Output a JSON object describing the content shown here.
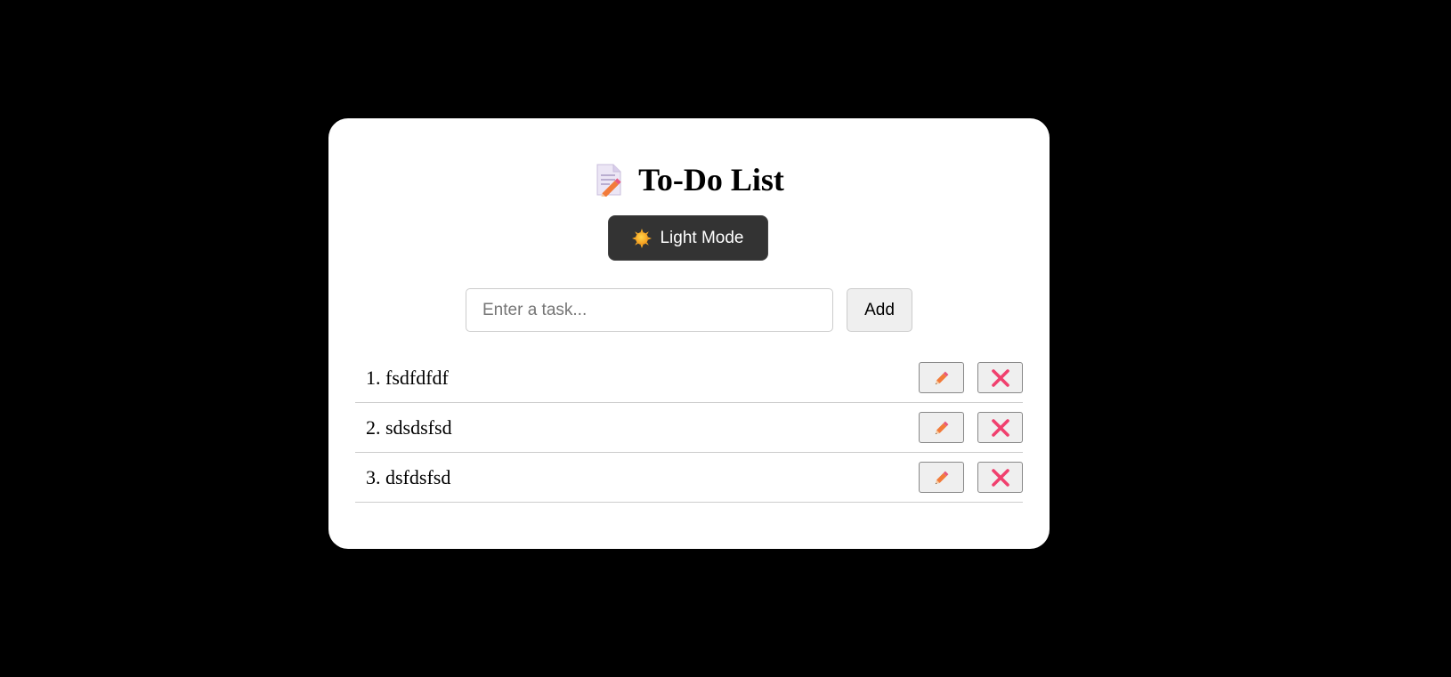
{
  "app": {
    "title": "To-Do List",
    "title_icon": "memo-pencil-icon"
  },
  "theme_toggle": {
    "label": "Light Mode",
    "icon": "sun-icon"
  },
  "new_task": {
    "placeholder": "Enter a task...",
    "value": "",
    "add_label": "Add"
  },
  "tasks": [
    {
      "label": "1. fsdfdfdf",
      "edit_icon": "pencil-icon",
      "delete_icon": "close-icon"
    },
    {
      "label": "2. sdsdsfsd",
      "edit_icon": "pencil-icon",
      "delete_icon": "close-icon"
    },
    {
      "label": "3. dsfdsfsd",
      "edit_icon": "pencil-icon",
      "delete_icon": "close-icon"
    }
  ],
  "colors": {
    "page_background": "#000000",
    "card_background": "#ffffff",
    "toggle_background": "#333333",
    "edit_icon": "#f08a3a",
    "delete_icon": "#f0406e"
  }
}
